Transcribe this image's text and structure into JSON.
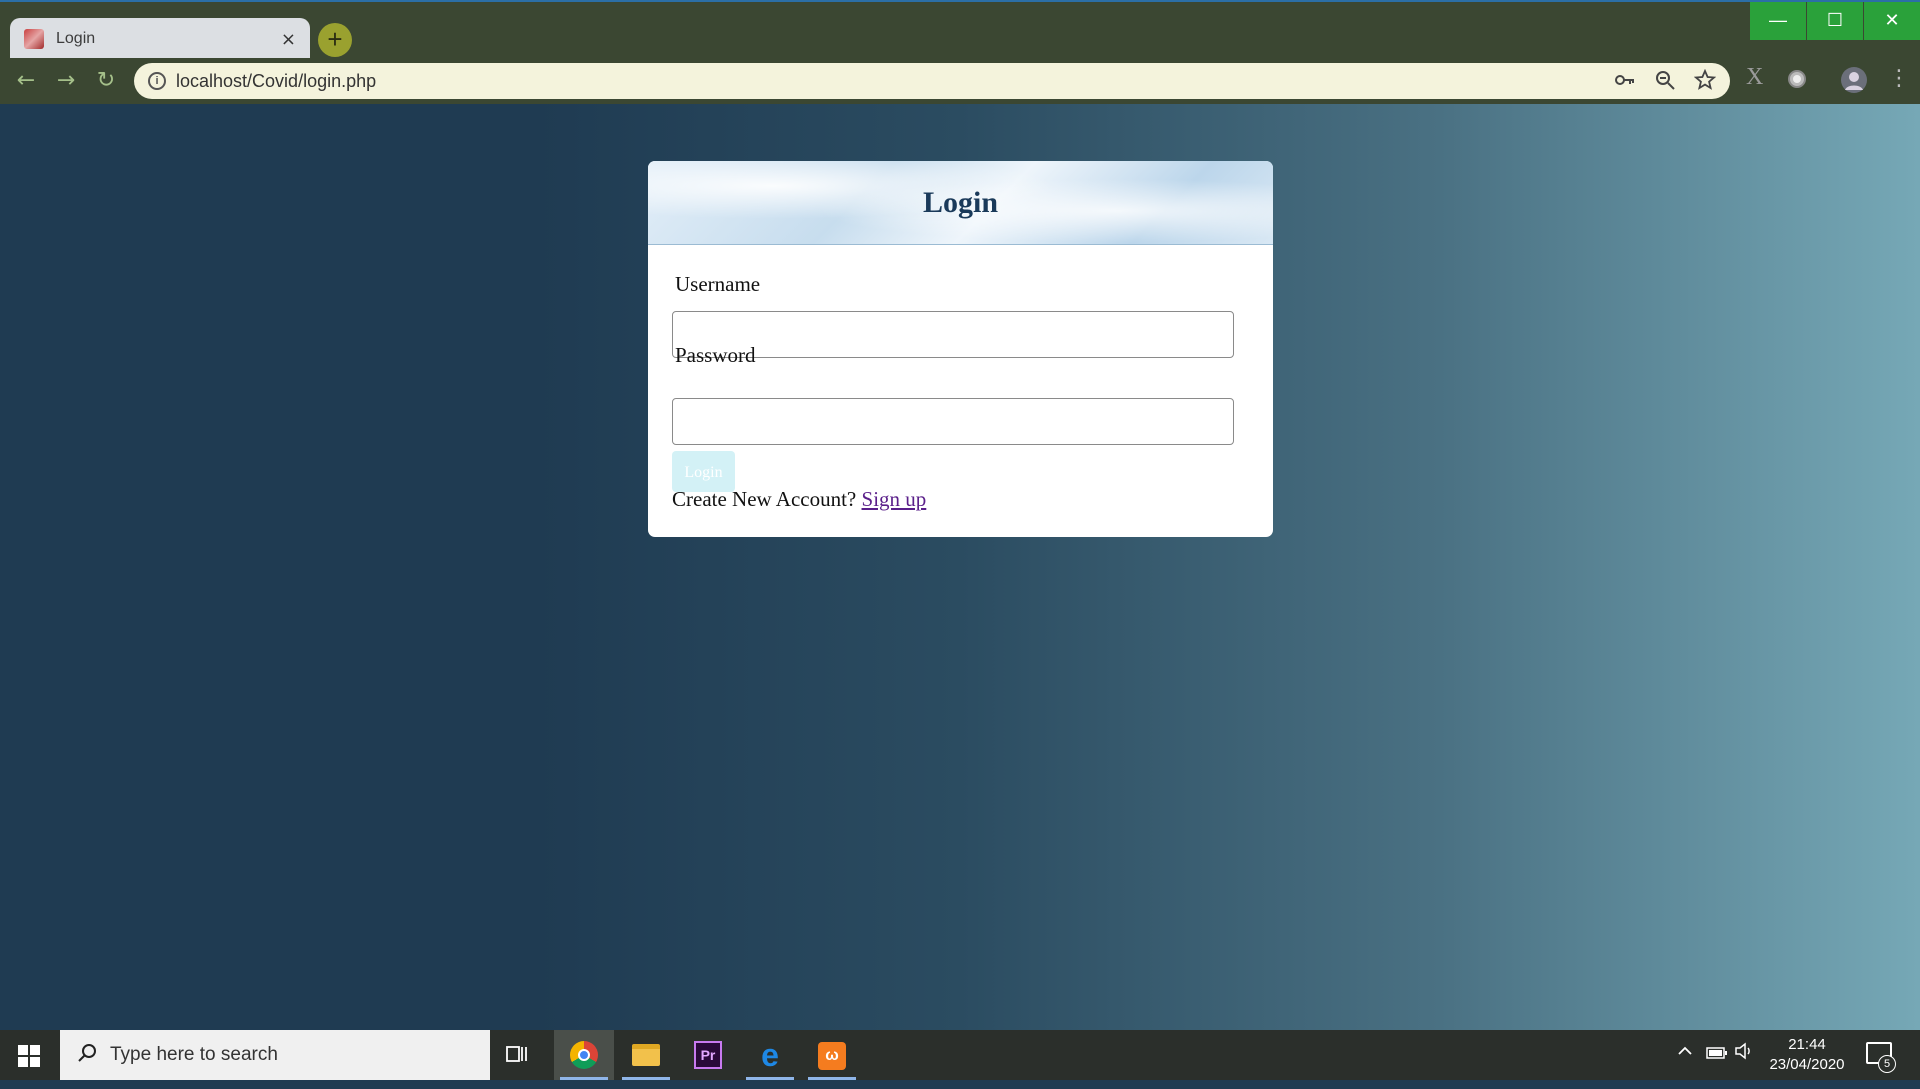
{
  "browser": {
    "tab": {
      "title": "Login",
      "close": "×"
    },
    "new_tab": "+",
    "window_controls": {
      "minimize": "—",
      "maximize": "☐",
      "close": "✕"
    },
    "nav": {
      "back": "←",
      "forward": "→",
      "reload": "↻"
    },
    "address_bar": {
      "url": "localhost/Covid/login.php"
    }
  },
  "login_card": {
    "title": "Login",
    "username_label": "Username",
    "username_value": "",
    "password_label": "Password",
    "password_value": "",
    "submit_label": "Login",
    "signup_prompt": "Create New Account?",
    "signup_link": "Sign up"
  },
  "taskbar": {
    "search_placeholder": "Type here to search",
    "apps": [
      "chrome-icon",
      "file-explorer-icon",
      "premiere-pro-icon",
      "edge-icon",
      "xampp-icon"
    ],
    "premiere_label": "Pr",
    "edge_label": "e",
    "clock": {
      "time": "21:44",
      "date": "23/04/2020"
    },
    "notification_count": "5"
  },
  "colors": {
    "page_left": "#1f3b52",
    "page_right": "#76a8b6",
    "login_button": "#d3f1f6",
    "signup_link": "#5a1f8a",
    "browser_frame": "#3b4732"
  }
}
